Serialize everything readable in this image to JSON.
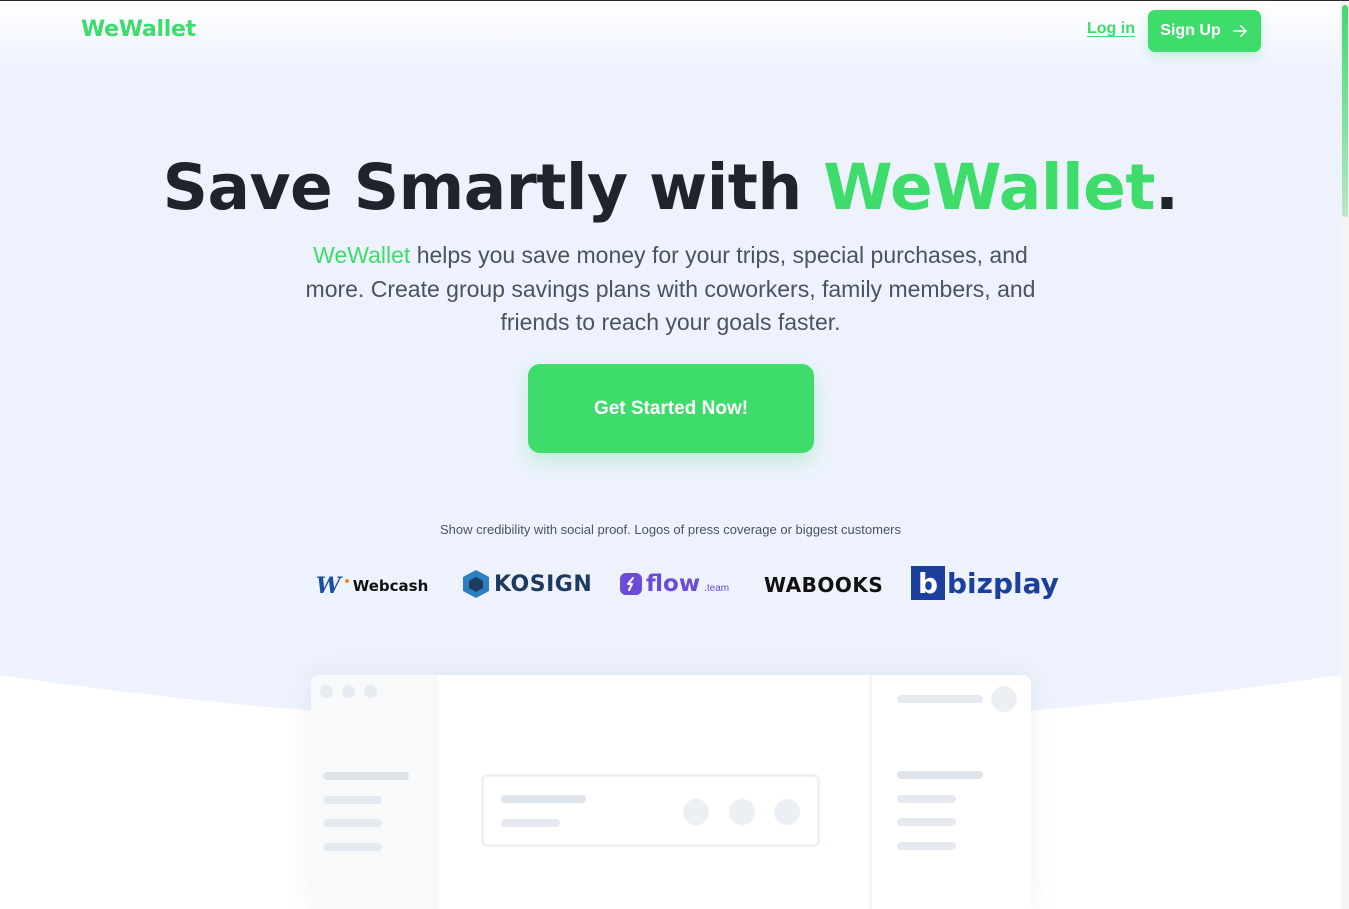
{
  "header": {
    "logo": "WeWallet",
    "login_label": "Log in",
    "signup_label": "Sign Up"
  },
  "hero": {
    "title_prefix": "Save Smartly with ",
    "title_accent": "WeWallet",
    "title_suffix": ".",
    "subtitle_accent": "WeWallet",
    "subtitle_rest": " helps you save money for your trips, special purchases, and more. Create group savings plans with coworkers, family members, and friends to reach your goals faster.",
    "cta_label": "Get Started Now!"
  },
  "social_proof": {
    "caption": "Show credibility with social proof. Logos of press coverage or biggest customers",
    "logos": [
      "Webcash",
      "KOSIGN",
      "flow",
      ".team",
      "WABOOKS",
      "bizplay"
    ]
  },
  "colors": {
    "brand": "#3ddc6b",
    "heading": "#1f242c",
    "body": "#4b5360",
    "hero_bg": "#edf2fd"
  }
}
